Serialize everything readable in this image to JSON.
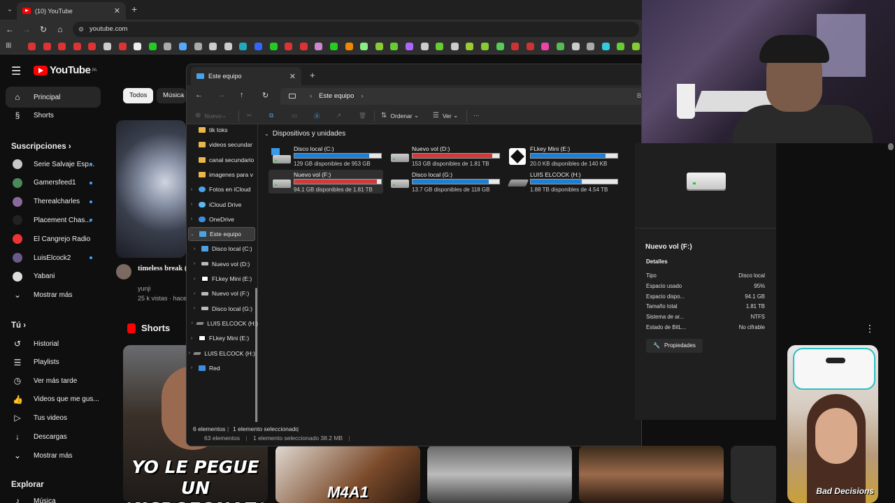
{
  "browser": {
    "tab_title": "(10) YouTube",
    "url": "youtube.com",
    "bookmark_colors": [
      "#d33",
      "#d33",
      "#d33",
      "#d33",
      "#d33",
      "#ccc",
      "#d33",
      "#eee",
      "#2c2",
      "#aaa",
      "#5af",
      "#aaa",
      "#ccc",
      "#ccc",
      "#2ab",
      "#36f",
      "#2c2",
      "#d33",
      "#d33",
      "#c8c",
      "#2c2",
      "#e80",
      "#8e8",
      "#8c3",
      "#6c3",
      "#a6f",
      "#ccc",
      "#6c3",
      "#ccc",
      "#9c3",
      "#8c3",
      "#5c5",
      "#c33",
      "#c33",
      "#e4a",
      "#5b5",
      "#ccc",
      "#aaa",
      "#3cd",
      "#6c3",
      "#8c3",
      "#ccc",
      "#ccc",
      "#ccc"
    ]
  },
  "youtube": {
    "region": "PA",
    "sidebar": {
      "home": "Principal",
      "shorts": "Shorts",
      "subs_header": "Suscripciones",
      "subs": [
        {
          "name": "Serie Salvaje Esp...",
          "color": "#c8c8c8",
          "dot": true
        },
        {
          "name": "Gamersfeed1",
          "color": "#4a8a5a",
          "dot": true
        },
        {
          "name": "Therealcharles",
          "color": "#8a6a9a",
          "dot": true
        },
        {
          "name": "Placement Chas...",
          "color": "#222",
          "dot": true
        },
        {
          "name": "El Cangrejo Radio",
          "color": "#e33",
          "dot": false
        },
        {
          "name": "LuisElcock2",
          "color": "#6a5a8a",
          "dot": true
        },
        {
          "name": "Yabani",
          "color": "#ddd",
          "dot": false
        }
      ],
      "more1": "Mostrar más",
      "you_header": "Tú",
      "you": [
        "Historial",
        "Playlists",
        "Ver más tarde",
        "Videos que me gus...",
        "Tus videos",
        "Descargas"
      ],
      "more2": "Mostrar más",
      "explore_header": "Explorar",
      "music": "Música"
    },
    "chips": [
      "Todos",
      "Música"
    ],
    "video": {
      "title": "timeless break (jungle/dub/br",
      "channel": "yunji",
      "views": "25 k vistas · hace"
    },
    "shorts_header": "Shorts",
    "shorts_captions": [
      "YO LE PEGUE UN MICROFONAZO",
      "M4A1",
      "Bad Decisions"
    ]
  },
  "explorer": {
    "tab_title": "Este equipo",
    "breadcrumb": "Este equipo",
    "search_hint": "Bu",
    "toolbar": {
      "new": "Nuevo",
      "sort": "Ordenar",
      "view": "Ver",
      "more": "···"
    },
    "nav": [
      {
        "label": "tik toks",
        "icon": "folder",
        "indent": 1,
        "chev": false
      },
      {
        "label": "videos secundar",
        "icon": "folder",
        "indent": 1,
        "chev": false
      },
      {
        "label": "canal secundario",
        "icon": "folder",
        "indent": 1,
        "chev": false
      },
      {
        "label": "imagenes para v",
        "icon": "folder",
        "indent": 1,
        "chev": false
      },
      {
        "label": "Fotos en iCloud",
        "icon": "photos",
        "indent": 1,
        "chev": true
      },
      {
        "label": "iCloud Drive",
        "icon": "icloud",
        "indent": 1,
        "chev": true
      },
      {
        "label": "OneDrive",
        "icon": "onedrive",
        "indent": 1,
        "chev": true
      },
      {
        "label": "Este equipo",
        "icon": "pc",
        "indent": 1,
        "chev": true,
        "expanded": true,
        "selected": true
      },
      {
        "label": "Disco local (C:)",
        "icon": "win",
        "indent": 2,
        "chev": true
      },
      {
        "label": "Nuevo vol (D:)",
        "icon": "hdd",
        "indent": 2,
        "chev": true
      },
      {
        "label": "FLkey Mini (E:)",
        "icon": "flkey",
        "indent": 2,
        "chev": true
      },
      {
        "label": "Nuevo vol (F:)",
        "icon": "hdd",
        "indent": 2,
        "chev": true
      },
      {
        "label": "Disco local (G:)",
        "icon": "hdd",
        "indent": 2,
        "chev": true
      },
      {
        "label": "LUIS ELCOCK (H:)",
        "icon": "usb",
        "indent": 2,
        "chev": true
      },
      {
        "label": "FLkey Mini (E:)",
        "icon": "flkey",
        "indent": 1,
        "chev": true
      },
      {
        "label": "LUIS ELCOCK (H:)",
        "icon": "usb",
        "indent": 1,
        "chev": true
      },
      {
        "label": "Red",
        "icon": "net",
        "indent": 1,
        "chev": true
      }
    ],
    "group_label": "Dispositivos y unidades",
    "drives": [
      {
        "name": "Disco local (C:)",
        "free": "129 GB disponibles de 953 GB",
        "used": 0.86,
        "color": "#1e7fd6",
        "icon": "win"
      },
      {
        "name": "Nuevo vol (D:)",
        "free": "153 GB disponibles de 1.81 TB",
        "used": 0.92,
        "color": "#d03a3a",
        "icon": "hdd"
      },
      {
        "name": "FLkey Mini (E:)",
        "free": "20.0 KB disponibles de 140 KB",
        "used": 0.86,
        "color": "#1e7fd6",
        "icon": "flkey"
      },
      {
        "name": "Nuevo vol (F:)",
        "free": "94.1 GB disponibles de 1.81 TB",
        "used": 0.95,
        "color": "#d03a3a",
        "icon": "hdd",
        "selected": true
      },
      {
        "name": "Disco local (G:)",
        "free": "13.7 GB disponibles de 118 GB",
        "used": 0.88,
        "color": "#1e7fd6",
        "icon": "hdd"
      },
      {
        "name": "LUIS ELCOCK (H:)",
        "free": "1.88 TB disponibles de 4.54 TB",
        "used": 0.59,
        "color": "#1e7fd6",
        "icon": "usb"
      }
    ],
    "status": {
      "count": "6 elementos",
      "selected": "1 elemento seleccionado"
    },
    "status2": {
      "count": "63 elementos",
      "selected": "1 elemento seleccionado  38.2 MB"
    },
    "details": {
      "title": "Nuevo vol (F:)",
      "section": "Detalles",
      "rows": [
        {
          "k": "Tipo",
          "v": "Disco local"
        },
        {
          "k": "Espacio usado",
          "v": "95%"
        },
        {
          "k": "Espacio dispo...",
          "v": "94.1 GB"
        },
        {
          "k": "Tamaño total",
          "v": "1.81 TB"
        },
        {
          "k": "Sistema de ar...",
          "v": "NTFS"
        },
        {
          "k": "Estado de BitL...",
          "v": "No cifrable"
        }
      ],
      "props_button": "Propiedades"
    }
  }
}
